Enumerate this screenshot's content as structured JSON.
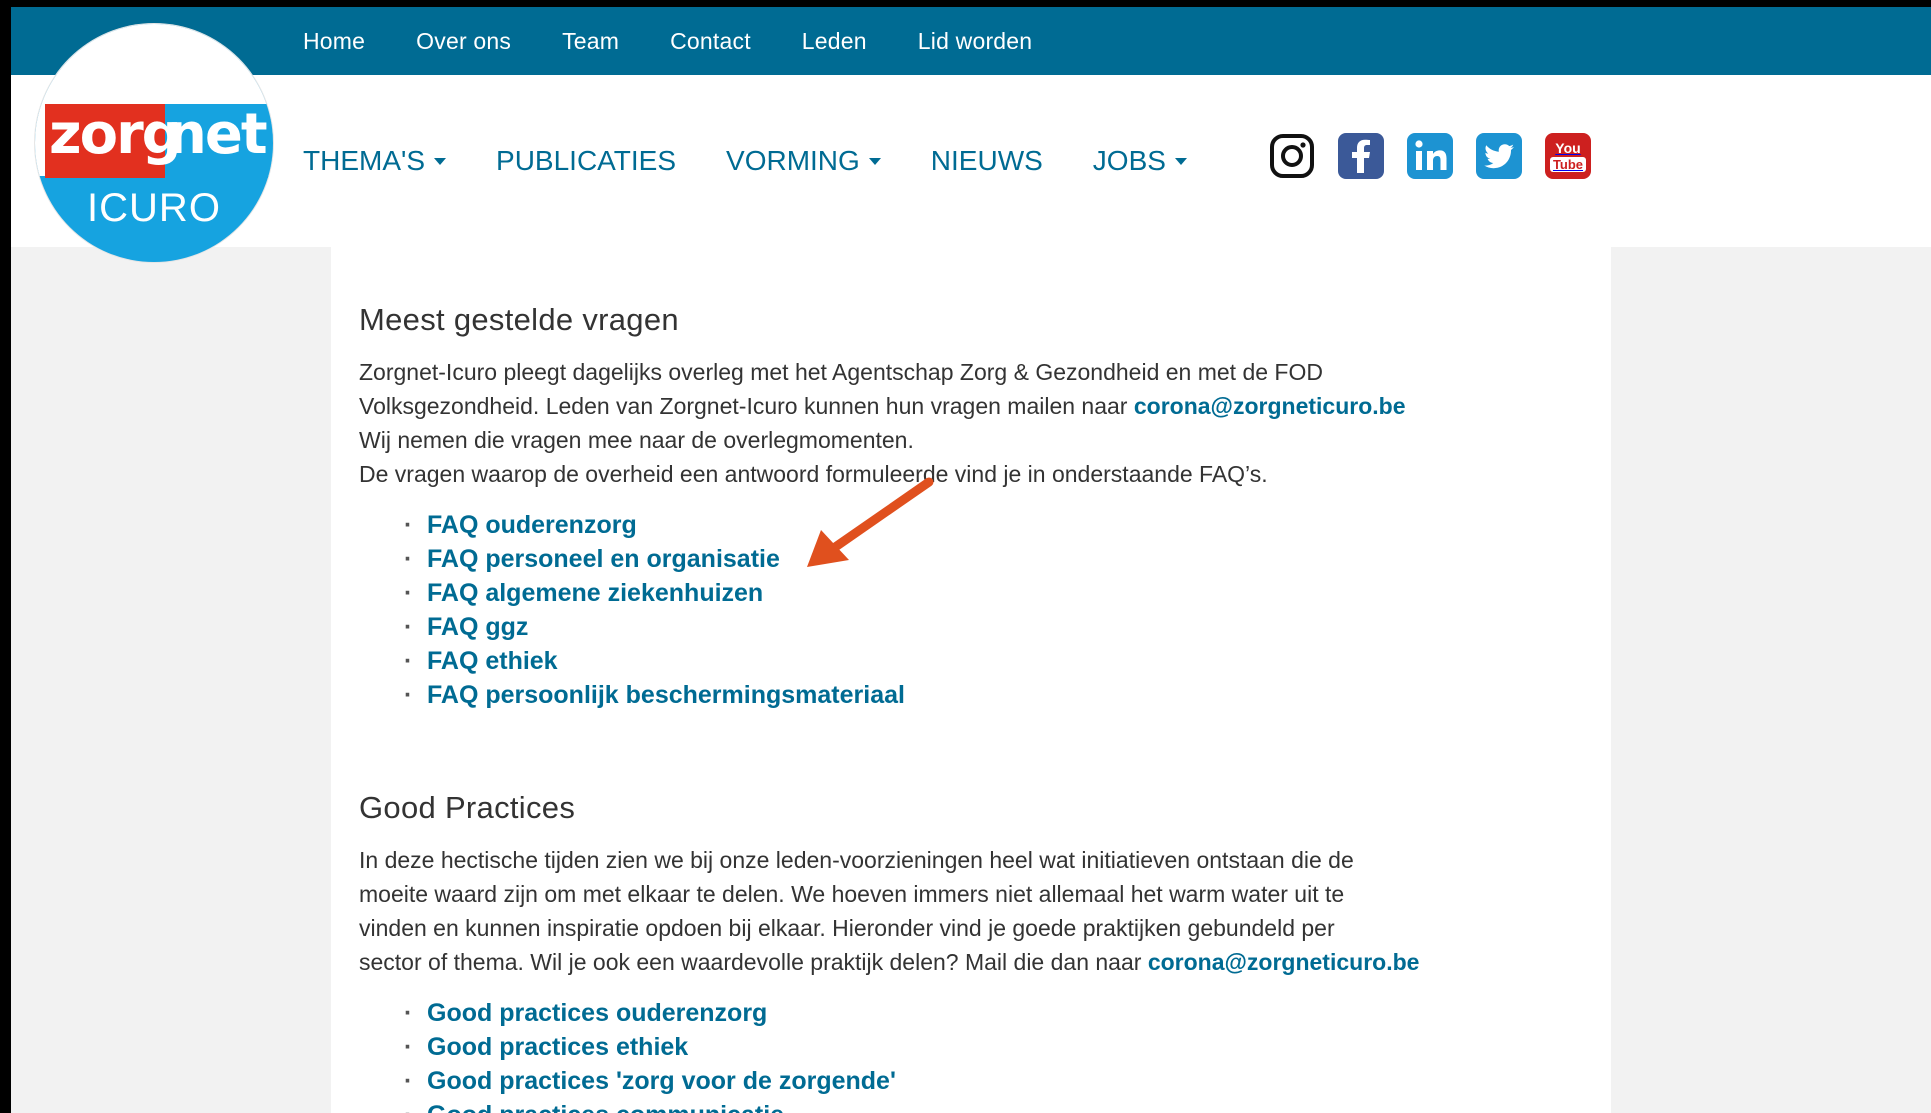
{
  "topnav": {
    "items": [
      "Home",
      "Over ons",
      "Team",
      "Contact",
      "Leden",
      "Lid worden"
    ]
  },
  "logo": {
    "word1": "zorg",
    "word2": "net",
    "word3": "ICURO"
  },
  "mainnav": {
    "items": [
      {
        "label": "THEMA'S",
        "dropdown": true
      },
      {
        "label": "PUBLICATIES",
        "dropdown": false
      },
      {
        "label": "VORMING",
        "dropdown": true
      },
      {
        "label": "NIEUWS",
        "dropdown": false
      },
      {
        "label": "JOBS",
        "dropdown": true
      }
    ]
  },
  "social": {
    "icons": [
      "instagram-icon",
      "facebook-icon",
      "linkedin-icon",
      "twitter-icon",
      "youtube-icon"
    ],
    "youtube_text1": "You",
    "youtube_text2": "Tube"
  },
  "faq": {
    "title": "Meest gestelde vragen",
    "line1": "Zorgnet-Icuro pleegt dagelijks overleg met het Agentschap Zorg & Gezondheid en met de FOD",
    "line2_pre": "Volksgezondheid. Leden van Zorgnet-Icuro kunnen hun vragen mailen naar ",
    "email": "corona@zorgneticuro.be",
    "line3": "Wij nemen die vragen mee naar de overlegmomenten.",
    "line4": "De vragen waarop de overheid een antwoord formuleerde vind je in onderstaande FAQ’s.",
    "links": [
      "FAQ ouderenzorg",
      "FAQ personeel en organisatie",
      "FAQ algemene ziekenhuizen",
      "FAQ ggz",
      "FAQ ethiek",
      "FAQ persoonlijk beschermingsmateriaal"
    ]
  },
  "good_practices": {
    "title": "Good Practices",
    "line1": "In deze hectische tijden zien we bij onze leden-voorzieningen heel wat initiatieven ontstaan die de",
    "line2": "moeite waard zijn om met elkaar te delen. We hoeven immers niet allemaal het warm water uit te",
    "line3": "vinden en kunnen inspiratie opdoen bij elkaar. Hieronder vind je goede praktijken gebundeld per",
    "line4_pre": "sector of thema. Wil je ook een waardevolle praktijk delen? Mail die dan naar ",
    "email": "corona@zorgneticuro.be",
    "links": [
      "Good practices ouderenzorg",
      "Good practices ethiek",
      "Good practices 'zorg voor de zorgende'",
      "Good practices communicatie"
    ]
  },
  "colors": {
    "brand_blue": "#006b93",
    "logo_red": "#e2301f",
    "logo_cyan": "#16a3e0",
    "annotation_arrow": "#e0501e"
  }
}
